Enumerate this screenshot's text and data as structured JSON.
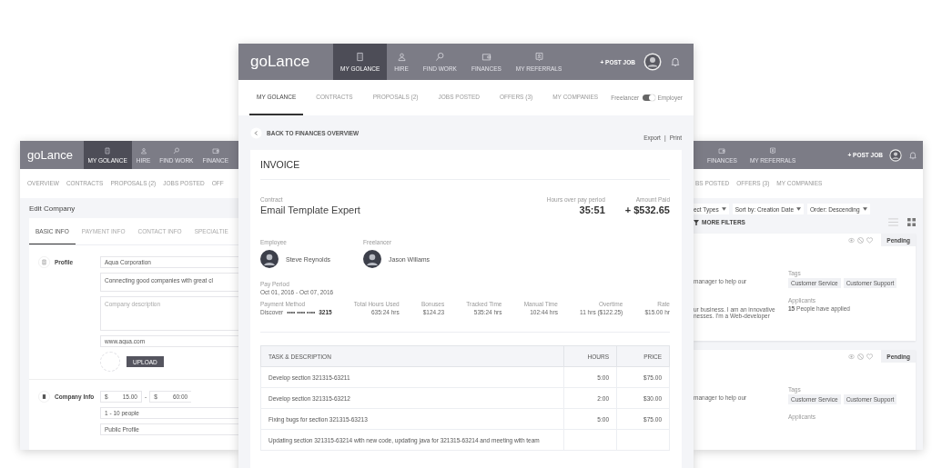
{
  "left_window": {
    "logo": "goLance",
    "nav": [
      {
        "label": "MY GOLANCE",
        "selected": true
      },
      {
        "label": "HIRE",
        "selected": false
      },
      {
        "label": "FIND WORK",
        "selected": false
      },
      {
        "label": "FINANCE",
        "selected": false
      }
    ],
    "subnav": [
      {
        "label": "OVERVIEW",
        "selected": false
      },
      {
        "label": "CONTRACTS",
        "selected": false
      },
      {
        "label": "PROPOSALS (2)",
        "selected": false
      },
      {
        "label": "JOBS POSTED",
        "selected": false
      },
      {
        "label": "OFF",
        "selected": false
      }
    ],
    "page_title": "Edit Company",
    "tabs": [
      {
        "label": "BASIC INFO",
        "selected": true
      },
      {
        "label": "PAYMENT INFO",
        "selected": false
      },
      {
        "label": "CONTACT INFO",
        "selected": false
      },
      {
        "label": "SPECIALTIE",
        "selected": false
      }
    ],
    "profile": {
      "label": "Profile",
      "name": "Aqua Corporation",
      "tagline": "Connecting good companies with great cl",
      "description_placeholder": "Company description",
      "website": "www.aqua.com",
      "upload_button": "UPLOAD"
    },
    "company_info": {
      "label": "Company Info",
      "rate_from": {
        "prefix": "$",
        "value": "15.00"
      },
      "range_separator": "-",
      "rate_to": {
        "prefix": "$",
        "value": "60:00"
      },
      "size": "1 - 10 people",
      "visibility": "Public Profile"
    }
  },
  "center_window": {
    "logo": "goLance",
    "nav": [
      {
        "label": "MY GOLANCE",
        "selected": true
      },
      {
        "label": "HIRE",
        "selected": false
      },
      {
        "label": "FIND WORK",
        "selected": false
      },
      {
        "label": "FINANCES",
        "selected": false
      },
      {
        "label": "MY REFERRALS",
        "selected": false
      }
    ],
    "post_job": "+ POST JOB",
    "subnav": [
      {
        "label": "MY GOLANCE",
        "selected": true
      },
      {
        "label": "CONTRACTS",
        "selected": false
      },
      {
        "label": "PROPOSALS (2)",
        "selected": false
      },
      {
        "label": "JOBS POSTED",
        "selected": false
      },
      {
        "label": "OFFERS (3)",
        "selected": false
      },
      {
        "label": "MY COMPANIES",
        "selected": false
      }
    ],
    "role_toggle": {
      "left_label": "Freelancer",
      "right_label": "Employer",
      "employer": true
    },
    "back_link": "BACK TO FINANCES OVERVIEW",
    "actions": {
      "export": "Export",
      "separator": "|",
      "print": "Print"
    },
    "invoice": {
      "title": "INVOICE",
      "contract_label": "Contract",
      "contract": "Email Template Expert",
      "hours_label": "Hours over pay period",
      "hours": "35:51",
      "amount_label": "Amount Paid",
      "amount": "+ $532.65",
      "people": [
        {
          "role": "Employee",
          "name": "Steve Reynolds"
        },
        {
          "role": "Freelancer",
          "name": "Jason Willams"
        }
      ],
      "pay_period_label": "Pay Period",
      "pay_period": "Oct 01, 2016 - Oct 07, 2016",
      "payment_method_label": "Payment Method",
      "payment_method": "Discover",
      "card_mask": "•••• •••• ••••",
      "card_last": "3215",
      "stats": [
        {
          "label": "Total Hours Used",
          "value": "635:24 hrs"
        },
        {
          "label": "Bonuses",
          "value": "$124.23"
        },
        {
          "label": "Tracked Time",
          "value": "535:24 hrs"
        },
        {
          "label": "Manual Time",
          "value": "102:44 hrs"
        },
        {
          "label": "Overtime",
          "value": "11 hrs ($122.25)"
        },
        {
          "label": "Rate",
          "value": "$15.00 hr"
        }
      ]
    },
    "table": {
      "columns": [
        "TASK & DESCRIPTION",
        "HOURS",
        "PRICE"
      ],
      "rows": [
        {
          "task": "Develop section 321315-63211",
          "hours": "5:00",
          "price": "$75.00"
        },
        {
          "task": "Develop section 321315-63212",
          "hours": "2:00",
          "price": "$30.00"
        },
        {
          "task": "Fixing bugs for section 321315-63213",
          "hours": "5:00",
          "price": "$75.00"
        },
        {
          "task": "Updating section 321315-63214 with new code, updating java for 321315-63214 and meeting with team"
        }
      ]
    }
  },
  "right_window": {
    "nav": [
      {
        "label": "FINANCES",
        "selected": false
      },
      {
        "label": "MY REFERRALS",
        "selected": false
      }
    ],
    "post_job": "+ POST JOB",
    "subnav": [
      {
        "label": "BS POSTED",
        "selected": false
      },
      {
        "label": "OFFERS (3)",
        "selected": false
      },
      {
        "label": "MY COMPANIES",
        "selected": false
      }
    ],
    "filters": [
      {
        "label": "ect Types"
      },
      {
        "label": "Sort by: Creation Date"
      },
      {
        "label": "Order: Descending"
      }
    ],
    "more_filters": "MORE FILTERS",
    "view_buttons": [
      {
        "kind": "list",
        "selected": false
      },
      {
        "kind": "grid",
        "selected": true
      }
    ],
    "cards": [
      {
        "status": "Pending",
        "text_1": "manager to help our",
        "text_2": "ur business. I am an innovative",
        "text_3": "nesses. I'm a Web-developer",
        "tags_label": "Tags",
        "tags": [
          "Customer Service",
          "Customer Support"
        ],
        "applicants_label": "Applicants",
        "applicants": "**15** People have applied"
      },
      {
        "status": "Pending",
        "text_1": "manager to help our",
        "tags_label": "Tags",
        "tags": [
          "Customer Service",
          "Customer Support"
        ],
        "applicants_label": "Applicants"
      }
    ]
  }
}
